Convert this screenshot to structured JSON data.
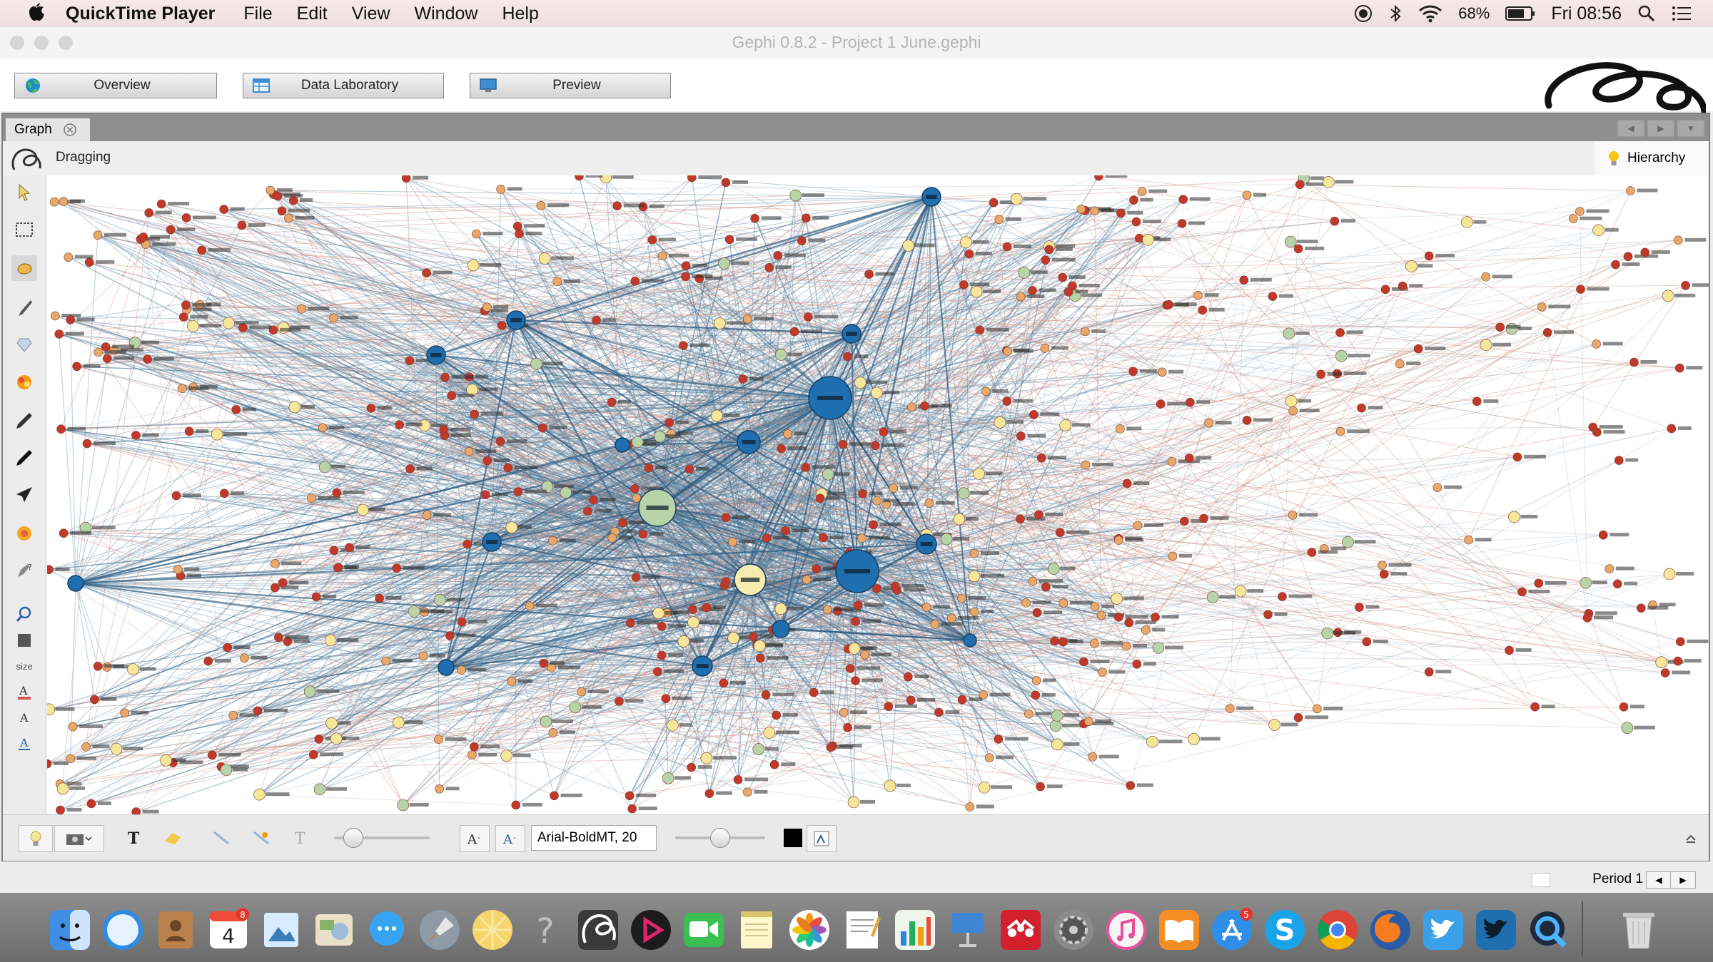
{
  "menubar": {
    "app_name": "QuickTime Player",
    "items": [
      "File",
      "Edit",
      "View",
      "Window",
      "Help"
    ],
    "battery": "68%",
    "clock": "Fri 08:56"
  },
  "window": {
    "title": "Gephi 0.8.2 - Project 1 June.gephi"
  },
  "toolbar": {
    "overview_label": "Overview",
    "data_lab_label": "Data Laboratory",
    "preview_label": "Preview"
  },
  "graph_panel": {
    "tab_label": "Graph",
    "mode_label": "Dragging",
    "hierarchy_label": "Hierarchy"
  },
  "bottom_bar": {
    "size_label": "size",
    "font_value": "Arial-BoldMT, 20"
  },
  "status": {
    "period_label": "Period 1"
  },
  "dock": {
    "calendar_day": "4",
    "calendar_badge": "8",
    "appstore_badge": "5"
  },
  "colors": {
    "hub_node": "#1f6fb0",
    "edge_blue": "#3d6c8f",
    "edge_red": "#c98a7a",
    "node_red": "#c0392b",
    "node_yellow": "#f5e79a",
    "node_green": "#b7d3a8"
  }
}
